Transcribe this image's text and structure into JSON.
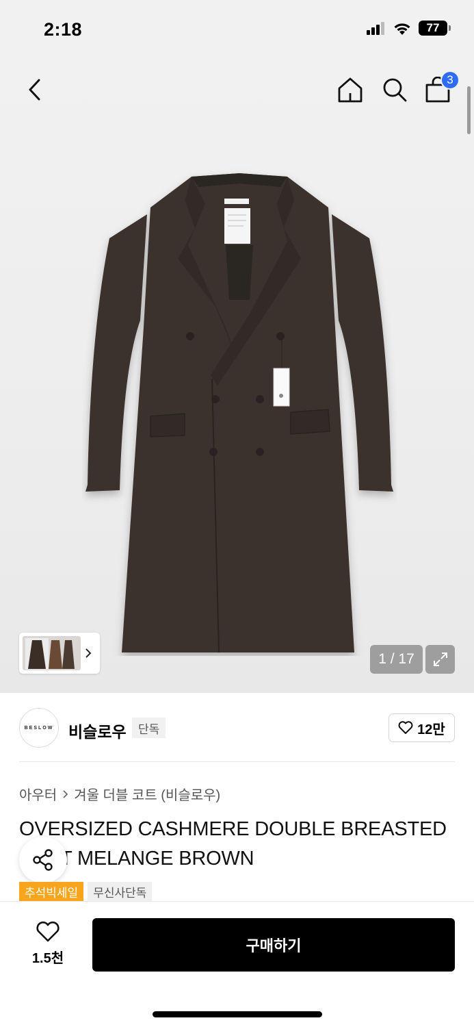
{
  "status_bar": {
    "time": "2:18",
    "battery": "77",
    "icons": [
      "signal-icon",
      "wifi-icon",
      "battery-icon"
    ]
  },
  "nav": {
    "back_icon": "chevron-left-icon",
    "home_icon": "home-icon",
    "search_icon": "search-icon",
    "bag_icon": "shopping-bag-icon",
    "cart_count": "3"
  },
  "gallery": {
    "counter": "1 / 17",
    "thumb_arrow_icon": "chevron-right-icon",
    "expand_icon": "expand-icon"
  },
  "brand": {
    "logo_text": "BESLOW",
    "name": "비슬로우",
    "tag": "단독",
    "likes": "12만"
  },
  "breadcrumb": {
    "category": "아우터",
    "subcategory": "겨울 더블 코트 (비슬로우)"
  },
  "product": {
    "title": "OVERSIZED CASHMERE DOUBLE BREASTED COAT MELANGE BROWN"
  },
  "tags": [
    "추석빅세일",
    "무신사단독"
  ],
  "bottom": {
    "wish_count": "1.5천",
    "buy_label": "구매하기"
  },
  "colors": {
    "badge_blue": "#2f6cf6",
    "sale_orange": "#f7a51c",
    "coat_brown": "#3b332e"
  }
}
